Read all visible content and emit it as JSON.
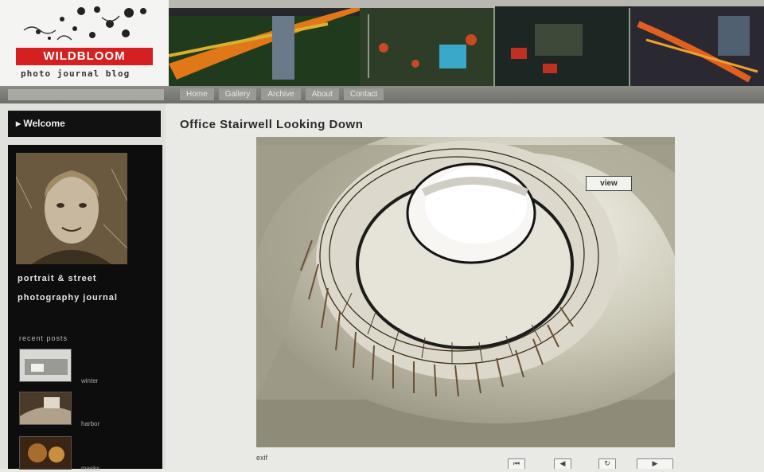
{
  "site": {
    "logo_name": "WILDBLOOM",
    "logo_tagline": "photo journal blog"
  },
  "header": {
    "nav": [
      "Home",
      "Gallery",
      "Archive",
      "About",
      "Contact"
    ]
  },
  "sidebar": {
    "heading": "▸ Welcome",
    "profile_line1": "portrait & street",
    "profile_line2": "photography journal",
    "recent_label": "recent posts",
    "recent": [
      {
        "caption": "winter"
      },
      {
        "caption": "harbor"
      },
      {
        "caption": "masks"
      }
    ]
  },
  "main": {
    "post_title": "Office Stairwell Looking Down",
    "photo_badge": "view",
    "photo_caption": "exif",
    "pager": [
      {
        "icon": "first-icon",
        "symbol": "⏮"
      },
      {
        "icon": "prev-icon",
        "symbol": "◀"
      },
      {
        "icon": "refresh-icon",
        "symbol": "↻"
      },
      {
        "icon": "next-icon",
        "symbol": "▶"
      }
    ]
  },
  "colors": {
    "logo_red": "#d42020",
    "sidebar_black": "#0d0d0d",
    "page_bg": "#e9e9e6"
  }
}
